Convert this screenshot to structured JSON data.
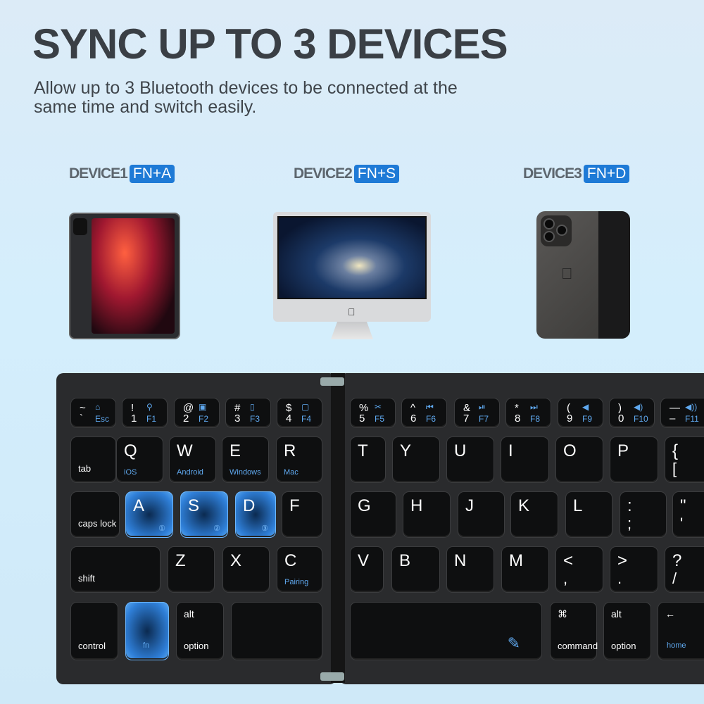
{
  "title": "SYNC UP TO 3 DEVICES",
  "subtitle": "Allow up to 3 Bluetooth devices to be connected at the same time and switch easily.",
  "devices": [
    {
      "label": "DEVICE1",
      "shortcut": "FN+A",
      "type": "tablet"
    },
    {
      "label": "DEVICE2",
      "shortcut": "FN+S",
      "type": "desktop"
    },
    {
      "label": "DEVICE3",
      "shortcut": "FN+D",
      "type": "phone"
    }
  ],
  "accent": "#1e7ad6",
  "keyboard": {
    "fn_row": [
      {
        "top": "~",
        "bottom": "`",
        "top_icon": "⌂",
        "bottom_icon": "Esc"
      },
      {
        "top": "!",
        "bottom": "1",
        "top_icon": "⚲",
        "bottom_icon": "F1"
      },
      {
        "top": "@",
        "bottom": "2",
        "top_icon": "▣",
        "bottom_icon": "F2"
      },
      {
        "top": "#",
        "bottom": "3",
        "top_icon": "▯",
        "bottom_icon": "F3"
      },
      {
        "top": "$",
        "bottom": "4",
        "top_icon": "▢",
        "bottom_icon": "F4"
      },
      {
        "top": "%",
        "bottom": "5",
        "top_icon": "✂",
        "bottom_icon": "F5"
      },
      {
        "top": "^",
        "bottom": "6",
        "top_icon": "⏮",
        "bottom_icon": "F6"
      },
      {
        "top": "&",
        "bottom": "7",
        "top_icon": "⏯",
        "bottom_icon": "F7"
      },
      {
        "top": "*",
        "bottom": "8",
        "top_icon": "⏭",
        "bottom_icon": "F8"
      },
      {
        "top": "(",
        "bottom": "9",
        "top_icon": "◀",
        "bottom_icon": "F9"
      },
      {
        "top": ")",
        "bottom": "0",
        "top_icon": "◀)",
        "bottom_icon": "F10"
      },
      {
        "top": "—",
        "bottom": "–",
        "top_icon": "◀))",
        "bottom_icon": "F11"
      }
    ],
    "keys": [
      {
        "main": "",
        "mod": "tab"
      },
      {
        "main": "Q",
        "sub": "iOS"
      },
      {
        "main": "W",
        "sub": "Android"
      },
      {
        "main": "E",
        "sub": "Windows"
      },
      {
        "main": "R",
        "sub": "Mac"
      },
      {
        "main": "T"
      },
      {
        "main": "Y"
      },
      {
        "main": "U"
      },
      {
        "main": "I"
      },
      {
        "main": "O"
      },
      {
        "main": "P"
      },
      {
        "main": "{",
        "sub2": "["
      },
      {
        "main": "",
        "mod": "caps lock"
      },
      {
        "main": "A",
        "num": "①",
        "highlight": true
      },
      {
        "main": "S",
        "num": "②",
        "highlight": true
      },
      {
        "main": "D",
        "num": "③",
        "highlight": true
      },
      {
        "main": "F"
      },
      {
        "main": "G"
      },
      {
        "main": "H"
      },
      {
        "main": "J"
      },
      {
        "main": "K"
      },
      {
        "main": "L"
      },
      {
        "main": ":",
        "sub2": ";"
      },
      {
        "main": "\"",
        "sub2": "'"
      },
      {
        "main": "",
        "mod": "shift"
      },
      {
        "main": "Z"
      },
      {
        "main": "X"
      },
      {
        "main": "C",
        "sub": "Pairing"
      },
      {
        "main": "V"
      },
      {
        "main": "B"
      },
      {
        "main": "N"
      },
      {
        "main": "M"
      },
      {
        "main": "<",
        "sub2": ","
      },
      {
        "main": ">",
        "sub2": "."
      },
      {
        "main": "?",
        "sub2": "/"
      },
      {
        "main": "",
        "mod": "control"
      },
      {
        "main": "",
        "fnlabel": "fn",
        "highlight": true
      },
      {
        "main": "",
        "topmod": "alt",
        "mod": "option"
      },
      {
        "main": ""
      },
      {
        "main": "",
        "icon": "✎"
      },
      {
        "main": "",
        "topmod": "⌘",
        "mod": "command"
      },
      {
        "main": "",
        "topmod": "alt",
        "mod": "option"
      },
      {
        "main": "",
        "topmod": "←",
        "fnlabel": "home"
      }
    ]
  }
}
